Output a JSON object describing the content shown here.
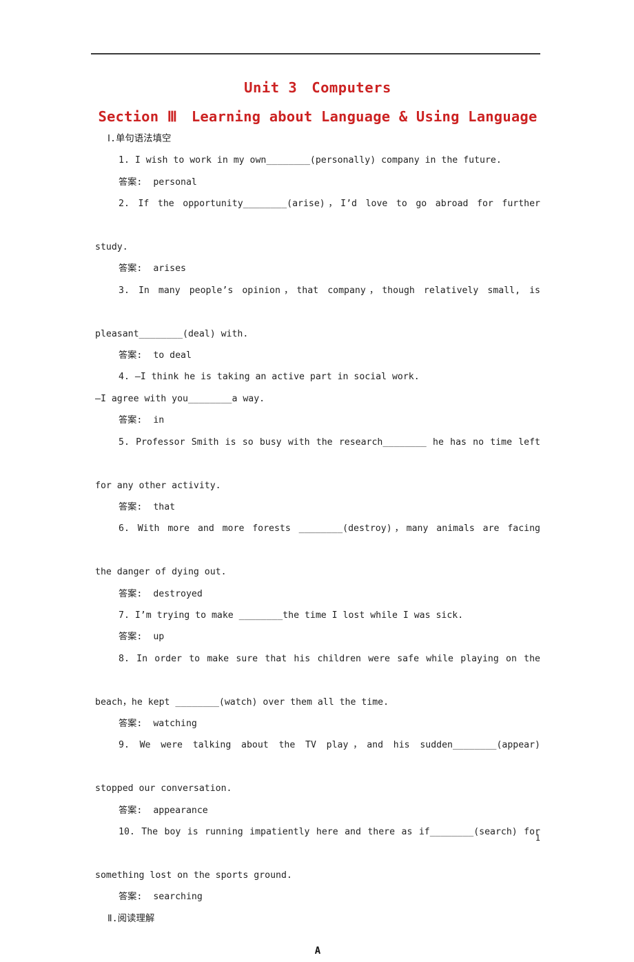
{
  "document": {
    "title_main": "Unit 3　Computers",
    "title_sub": "Section Ⅲ　Learning about Language & Using Language",
    "title_color": "#cc2222",
    "page_number": "1"
  },
  "section_one": {
    "heading": "Ⅰ.单句语法填空",
    "items": [
      {
        "number": "1.",
        "text_before": "1. I wish to work in my own",
        "text_after": "(personally) company in the future.",
        "full": "1. I wish to work in my own________(personally) company in the future.",
        "answer_label": "答案:",
        "answer_value": "personal",
        "lines": [
          "1. I wish to work in my own________(personally) company in the future."
        ]
      },
      {
        "number": "2.",
        "text_before": "2. If the opportunity",
        "text_after": "(arise)，I’d love to go abroad for further study.",
        "full": "2. If the opportunity________(arise)，I’d love to go abroad for further study.",
        "answer_label": "答案:",
        "answer_value": "arises",
        "lines": [
          "2. If the opportunity________(arise)，I’d love to go abroad for further",
          "study."
        ]
      },
      {
        "number": "3.",
        "text_before": "3. In many people’s opinion，that company，though relatively small, is pleasant",
        "text_after": "(deal) with.",
        "full": "3. In many people’s opinion，that company，though relatively small, is pleasant________(deal) with.",
        "answer_label": "答案:",
        "answer_value": "to deal",
        "lines": [
          "3. In many people’s opinion，that company，though relatively small, is",
          "pleasant________(deal) with."
        ]
      },
      {
        "number": "4.",
        "text_before": "4. —I think he is taking an active part in social work.",
        "text_after": "—I agree with you________a way.",
        "full": "4. —I think he is taking an active part in social work. —I agree with you________a way.",
        "answer_label": "答案:",
        "answer_value": "in",
        "lines": [
          "4. —I think he is taking an active part in social work.",
          "—I agree with you________a way."
        ]
      },
      {
        "number": "5.",
        "text_before": "5. Professor Smith is so busy with the research",
        "text_after": "he has no time left for any other activity.",
        "full": "5. Professor Smith is so busy with the research________ he has no time left for any other activity.",
        "answer_label": "答案:",
        "answer_value": "that",
        "lines": [
          "5. Professor Smith is so busy with the research________ he has no time left",
          "for any other activity."
        ]
      },
      {
        "number": "6.",
        "text_before": "6. With more and more forests",
        "text_after": "(destroy)，many animals are facing the danger of dying out.",
        "full": "6. With more and more forests ________(destroy)，many animals are facing the danger of dying out.",
        "answer_label": "答案:",
        "answer_value": "destroyed",
        "lines": [
          "6. With more and more forests ________(destroy)，many animals are facing",
          "the danger of dying out."
        ]
      },
      {
        "number": "7.",
        "text_before": "7. I’m trying to make",
        "text_after": "the time I lost while I was sick.",
        "full": "7. I’m trying to make ________the time I lost while I was sick.",
        "answer_label": "答案:",
        "answer_value": "up",
        "lines": [
          "7. I’m trying to make ________the time I lost while I was sick."
        ]
      },
      {
        "number": "8.",
        "text_before": "8. In order to make sure that his children were safe while playing on the beach，he kept",
        "text_after": "(watch) over them all the time.",
        "full": "8. In order to make sure that his children were safe while playing on the beach，he kept ________(watch) over them all the time.",
        "answer_label": "答案:",
        "answer_value": "watching",
        "lines": [
          "8. In order to make sure that his children were safe while playing on the",
          "beach，he kept ________(watch) over them all the time."
        ]
      },
      {
        "number": "9.",
        "text_before": "9. We were talking about the TV play，and his sudden",
        "text_after": "(appear) stopped our conversation.",
        "full": "9. We were talking about the TV play，and his sudden________(appear) stopped our conversation.",
        "answer_label": "答案:",
        "answer_value": "appearance",
        "lines": [
          "9. We were talking about the TV play，and his sudden________(appear)",
          "stopped our conversation."
        ]
      },
      {
        "number": "10.",
        "text_before": "10. The boy is running impatiently here and there as if",
        "text_after": "(search) for something lost on the sports ground.",
        "full": "10. The boy is running impatiently here and there as if________(search) for something lost on the sports ground.",
        "answer_label": "答案:",
        "answer_value": "searching",
        "lines": [
          "10. The boy is running impatiently here and there as if________(search) for",
          "something lost on the sports ground."
        ]
      }
    ]
  },
  "section_two": {
    "heading": "Ⅱ.阅读理解",
    "passage_label": "A"
  }
}
